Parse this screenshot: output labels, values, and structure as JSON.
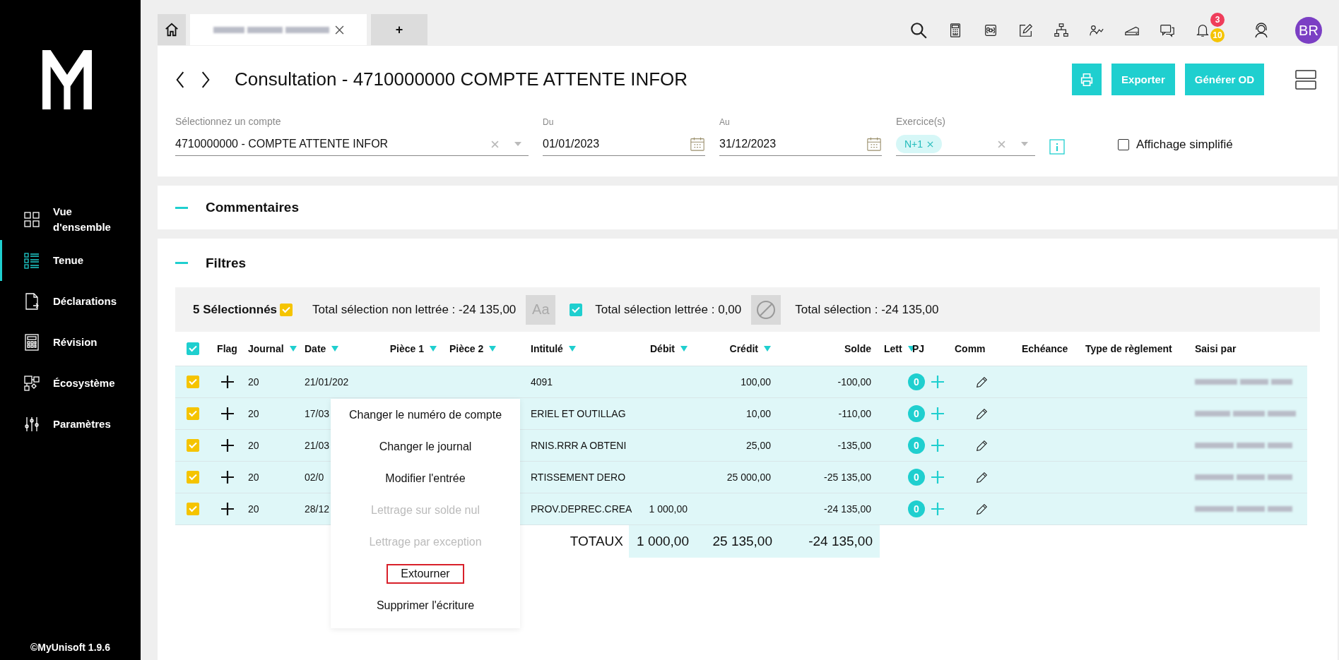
{
  "sidebar": {
    "items": [
      {
        "label": "Vue d'ensemble",
        "selected": false
      },
      {
        "label": "Tenue",
        "selected": true
      },
      {
        "label": "Déclarations",
        "selected": false
      },
      {
        "label": "Révision",
        "selected": false
      },
      {
        "label": "Écosystème",
        "selected": false
      },
      {
        "label": "Paramètres",
        "selected": false
      }
    ],
    "version": "©MyUnisoft 1.9.6"
  },
  "tabs": [
    {
      "kind": "home",
      "selected": false
    },
    {
      "kind": "document",
      "selected": true,
      "closable": true
    },
    {
      "kind": "new",
      "label": "+",
      "selected": false
    }
  ],
  "toolbar": {
    "notifications": {
      "alerts": "3",
      "messages": "10"
    },
    "avatar": "BR"
  },
  "header": {
    "title": "Consultation - 4710000000 COMPTE ATTENTE INFOR",
    "buttons": [
      {
        "kind": "print"
      },
      {
        "kind": "text",
        "label": "Exporter"
      },
      {
        "kind": "text",
        "label": "Générer OD"
      }
    ],
    "account": {
      "label": "Sélectionnez un compte",
      "value": "4710000000 - COMPTE ATTENTE INFOR"
    },
    "from": {
      "label": "Du",
      "value": "01/01/2023"
    },
    "to": {
      "label": "Au",
      "value": "31/12/2023"
    },
    "exercises": {
      "label": "Exercice(s)",
      "chips": [
        "N+1"
      ]
    },
    "simplified": {
      "label": "Affichage simplifié",
      "checked": false
    }
  },
  "comments": {
    "title": "Commentaires"
  },
  "filters": {
    "title": "Filtres",
    "selection_bar": {
      "count": "5 Sélectionnés",
      "count_checked": true,
      "unlettered_total": "Total sélection non lettrée : -24 135,00",
      "lettered_checked": true,
      "lettered_total": "Total sélection lettrée : 0,00",
      "total": "Total sélection : -24 135,00",
      "letter_button": "Aa"
    },
    "table": {
      "header_checked": true,
      "columns": [
        {
          "label": "Flag",
          "filter": false
        },
        {
          "label": "Journal",
          "filter": true
        },
        {
          "label": "Date",
          "filter": true
        },
        {
          "label": "Pièce 1",
          "filter": true
        },
        {
          "label": "Pièce 2",
          "filter": true
        },
        {
          "label": "Intitulé",
          "filter": true
        },
        {
          "label": "Débit",
          "filter": true
        },
        {
          "label": "Crédit",
          "filter": true
        },
        {
          "label": "Solde",
          "filter": false
        },
        {
          "label": "Lett",
          "filter": true
        },
        {
          "label": "PJ",
          "filter": false
        },
        {
          "label": "Comm",
          "filter": false
        },
        {
          "label": "Echéance",
          "filter": false
        },
        {
          "label": "Type de règlement",
          "filter": false
        },
        {
          "label": "Saisi par",
          "filter": false
        }
      ],
      "rows": [
        {
          "checked": true,
          "journal": "20",
          "date": "21/01/202",
          "intitule": "4091",
          "credit": "100,00",
          "solde": "-100,00",
          "attachments": "0"
        },
        {
          "checked": true,
          "journal": "20",
          "date": "17/03",
          "intitule": "ERIEL ET OUTILLAG",
          "credit": "10,00",
          "solde": "-110,00",
          "attachments": "0"
        },
        {
          "checked": true,
          "journal": "20",
          "date": "21/03",
          "intitule": "RNIS.RRR A OBTENI",
          "credit": "25,00",
          "solde": "-135,00",
          "attachments": "0"
        },
        {
          "checked": true,
          "journal": "20",
          "date": "02/0",
          "intitule": "RTISSEMENT DERO",
          "credit": "25 000,00",
          "solde": "-25 135,00",
          "attachments": "0"
        },
        {
          "checked": true,
          "journal": "20",
          "date": "28/12",
          "intitule": "PROV.DEPREC.CREA",
          "debit": "1 000,00",
          "solde": "-24 135,00",
          "attachments": "0"
        }
      ],
      "totals": {
        "label": "TOTAUX",
        "debit": "1 000,00",
        "credit": "25 135,00",
        "solde": "-24 135,00"
      }
    },
    "context_menu": {
      "items": [
        {
          "label": "Changer le numéro de compte",
          "disabled": false,
          "selected": false
        },
        {
          "label": "Changer le journal",
          "disabled": false,
          "selected": false
        },
        {
          "label": "Modifier l'entrée",
          "disabled": false,
          "selected": false
        },
        {
          "label": "Lettrage sur solde nul",
          "disabled": true,
          "selected": false
        },
        {
          "label": "Lettrage par exception",
          "disabled": true,
          "selected": false
        },
        {
          "label": "Extourner",
          "disabled": false,
          "selected": true
        },
        {
          "label": "Supprimer l'écriture",
          "disabled": false,
          "selected": false
        }
      ]
    }
  }
}
